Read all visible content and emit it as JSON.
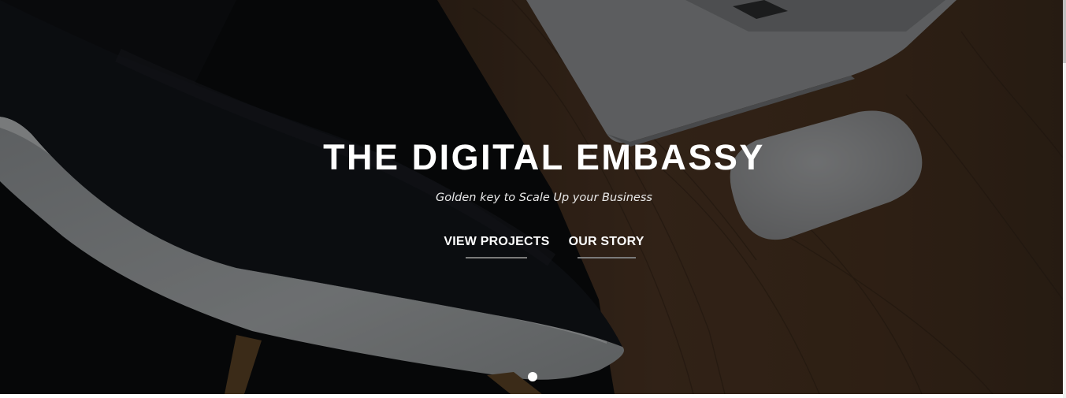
{
  "hero": {
    "title": "THE DIGITAL EMBASSY",
    "subtitle": "Golden key to Scale Up your Business",
    "buttons": [
      {
        "label": "VIEW PROJECTS"
      },
      {
        "label": "OUR STORY"
      }
    ],
    "slides": {
      "count": 1,
      "active_index": 0
    }
  },
  "colors": {
    "overlay": "#000000",
    "text": "#ffffff",
    "underline": "#7a7a7a",
    "wood": "#4a3424",
    "device": "#9a9c9e"
  },
  "icons": {
    "slide_indicator": "dot-icon"
  }
}
